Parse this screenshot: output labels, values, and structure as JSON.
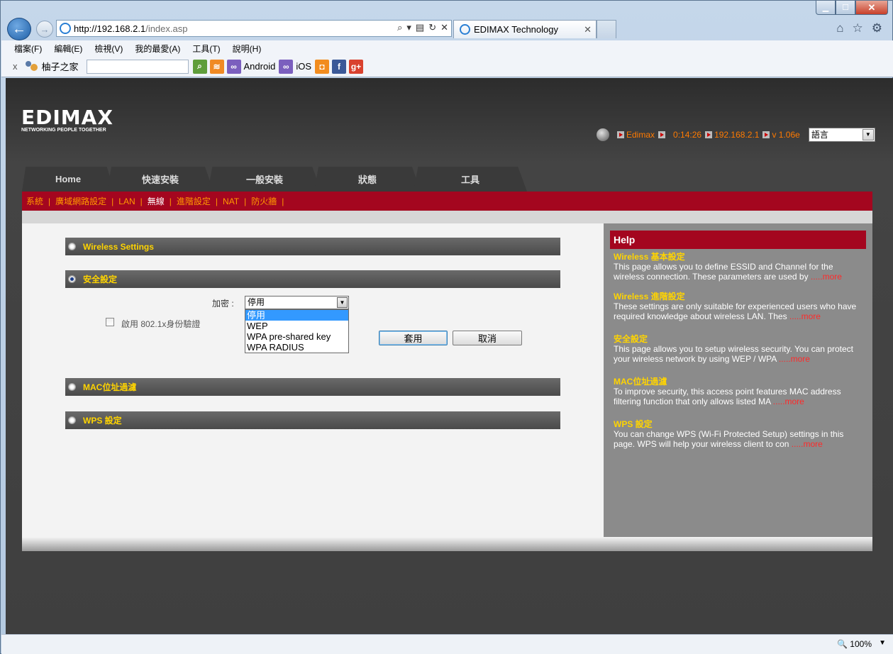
{
  "browser": {
    "address_host": "http://192.168.2.1",
    "address_path": "/index.asp",
    "tab_title": "EDIMAX Technology",
    "menu": [
      "檔案(F)",
      "編輯(E)",
      "檢視(V)",
      "我的最愛(A)",
      "工具(T)",
      "說明(H)"
    ],
    "fav_user": "柚子之家",
    "fav_android": "Android",
    "fav_ios": "iOS",
    "zoom": "100%"
  },
  "header": {
    "logo": "EDIMAX",
    "tagline": "NETWORKING PEOPLE TOGETHER",
    "user": "Edimax",
    "uptime": "0:14:26",
    "ip": "192.168.2.1",
    "version": "v 1.06e",
    "language": "語言"
  },
  "main_tabs": [
    "Home",
    "快速安裝",
    "一般安裝",
    "狀態",
    "工具"
  ],
  "subnav": [
    "系統",
    "廣域網路設定",
    "LAN",
    "無線",
    "進階設定",
    "NAT",
    "防火牆"
  ],
  "sections": {
    "wireless": "Wireless Settings",
    "security": "安全設定",
    "mac": "MAC位址過濾",
    "wps": "WPS 設定"
  },
  "form": {
    "encryption_label": "加密 :",
    "encryption_value": "停用",
    "options": [
      "停用",
      "WEP",
      "WPA pre-shared key",
      "WPA RADIUS"
    ],
    "checkbox_label": "啟用 802.1x身份驗證",
    "apply": "套用",
    "cancel": "取消"
  },
  "help": {
    "title": "Help",
    "more": ".....more",
    "blocks": [
      {
        "title": "Wireless 基本設定",
        "text": "This page allows you to define ESSID and Channel for the wireless connection. These parameters are used by "
      },
      {
        "title": "Wireless 進階設定",
        "text": "These settings are only suitable for experienced users who have required knowledge about wireless LAN. Thes "
      },
      {
        "title": "安全設定",
        "text": "This page allows you to setup wireless security. You can protect your wireless network by using WEP / WPA "
      },
      {
        "title": "MAC位址過濾",
        "text": "To improve security, this access point features MAC address filtering function that only allows listed MA "
      },
      {
        "title": "WPS 設定",
        "text": "You can change WPS (Wi-Fi Protected Setup) settings in this page. WPS will help your wireless client to con "
      }
    ]
  }
}
